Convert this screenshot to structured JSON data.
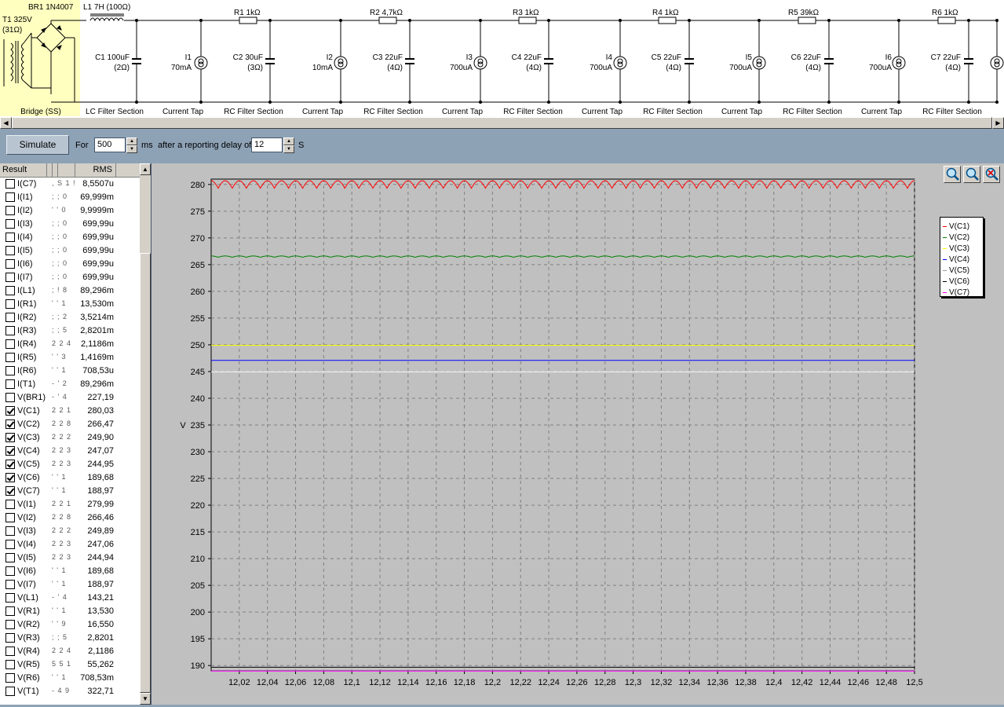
{
  "schematic": {
    "labels": {
      "br1": "BR1 1N4007",
      "t1": "T1 325V",
      "t1r": "(31Ω)",
      "l1": "L1 7H (100Ω)",
      "r1": "R1 1kΩ",
      "r2": "R2 4,7kΩ",
      "r3": "R3 1kΩ",
      "r4": "R4 1kΩ",
      "r5": "R5 39kΩ",
      "r6": "R6 1kΩ",
      "c1": "C1 100uF",
      "c1r": "(2Ω)",
      "c2": "C2 30uF",
      "c2r": "(3Ω)",
      "c3": "C3 22uF",
      "c3r": "(4Ω)",
      "c4": "C4 22uF",
      "c4r": "(4Ω)",
      "c5": "C5 22uF",
      "c5r": "(4Ω)",
      "c6": "C6 22uF",
      "c6r": "(4Ω)",
      "c7": "C7 22uF",
      "c7r": "(4Ω)",
      "i1": "I1",
      "i1v": "70mA",
      "i2": "I2",
      "i2v": "10mA",
      "i3": "I3",
      "i3v": "700uA",
      "i4": "I4",
      "i4v": "700uA",
      "i5": "I5",
      "i5v": "700uA",
      "i6": "I6",
      "i6v": "700uA"
    },
    "sections": {
      "bridge": "Bridge (SS)",
      "lc": "LC Filter Section",
      "ct1": "Current Tap",
      "rc1": "RC Filter Section",
      "ct2": "Current Tap",
      "rc2": "RC Filter Section",
      "ct3": "Current Tap",
      "rc3": "RC Filter Section",
      "ct4": "Current Tap",
      "rc4": "RC Filter Section",
      "ct5": "Current Tap",
      "rc5": "RC Filter Section",
      "ct6": "Current Tap",
      "rc6": "RC Filter Section"
    }
  },
  "toolbar": {
    "simulate": "Simulate",
    "for_label": "For",
    "duration": "500",
    "ms_label": "ms",
    "delay_label": "after a reporting delay of",
    "delay": "12",
    "s_label": "S"
  },
  "results": {
    "col_result": "Result",
    "col_rms": "RMS",
    "rows": [
      {
        "name": "I(C7)",
        "mid": ", S 1 !",
        "rms": "8,5507u",
        "checked": false
      },
      {
        "name": "I(I1)",
        "mid": "; ; 0",
        "rms": "69,999m",
        "checked": false
      },
      {
        "name": "I(I2)",
        "mid": "' ' 0",
        "rms": "9,9999m",
        "checked": false
      },
      {
        "name": "I(I3)",
        "mid": "; ; 0",
        "rms": "699,99u",
        "checked": false
      },
      {
        "name": "I(I4)",
        "mid": "; ; 0",
        "rms": "699,99u",
        "checked": false
      },
      {
        "name": "I(I5)",
        "mid": "; ; 0",
        "rms": "699,99u",
        "checked": false
      },
      {
        "name": "I(I6)",
        "mid": "; ; 0",
        "rms": "699,99u",
        "checked": false
      },
      {
        "name": "I(I7)",
        "mid": "; ; 0",
        "rms": "699,99u",
        "checked": false
      },
      {
        "name": "I(L1)",
        "mid": "; ! 8",
        "rms": "89,296m",
        "checked": false
      },
      {
        "name": "I(R1)",
        "mid": "' ' 1",
        "rms": "13,530m",
        "checked": false
      },
      {
        "name": "I(R2)",
        "mid": "; ; 2",
        "rms": "3,5214m",
        "checked": false
      },
      {
        "name": "I(R3)",
        "mid": "; ; 5",
        "rms": "2,8201m",
        "checked": false
      },
      {
        "name": "I(R4)",
        "mid": "2 2 4",
        "rms": "2,1186m",
        "checked": false
      },
      {
        "name": "I(R5)",
        "mid": "' ' 3",
        "rms": "1,4169m",
        "checked": false
      },
      {
        "name": "I(R6)",
        "mid": "' ' 1",
        "rms": "708,53u",
        "checked": false
      },
      {
        "name": "I(T1)",
        "mid": "- ' 2",
        "rms": "89,296m",
        "checked": false
      },
      {
        "name": "V(BR1)",
        "mid": "- ' 4",
        "rms": "227,19",
        "checked": false
      },
      {
        "name": "V(C1)",
        "mid": "2 2 1",
        "rms": "280,03",
        "checked": true
      },
      {
        "name": "V(C2)",
        "mid": "2 2 8",
        "rms": "266,47",
        "checked": true
      },
      {
        "name": "V(C3)",
        "mid": "2 2 2",
        "rms": "249,90",
        "checked": true
      },
      {
        "name": "V(C4)",
        "mid": "2 2 3",
        "rms": "247,07",
        "checked": true
      },
      {
        "name": "V(C5)",
        "mid": "2 2 3",
        "rms": "244,95",
        "checked": true
      },
      {
        "name": "V(C6)",
        "mid": "' ' 1",
        "rms": "189,68",
        "checked": true
      },
      {
        "name": "V(C7)",
        "mid": "' ' 1",
        "rms": "188,97",
        "checked": true
      },
      {
        "name": "V(I1)",
        "mid": "2 2 1",
        "rms": "279,99",
        "checked": false
      },
      {
        "name": "V(I2)",
        "mid": "2 2 8",
        "rms": "266,46",
        "checked": false
      },
      {
        "name": "V(I3)",
        "mid": "2 2 2",
        "rms": "249,89",
        "checked": false
      },
      {
        "name": "V(I4)",
        "mid": "2 2 3",
        "rms": "247,06",
        "checked": false
      },
      {
        "name": "V(I5)",
        "mid": "2 2 3",
        "rms": "244,94",
        "checked": false
      },
      {
        "name": "V(I6)",
        "mid": "' ' 1",
        "rms": "189,68",
        "checked": false
      },
      {
        "name": "V(I7)",
        "mid": "' ' 1",
        "rms": "188,97",
        "checked": false
      },
      {
        "name": "V(L1)",
        "mid": "- ' 4",
        "rms": "143,21",
        "checked": false
      },
      {
        "name": "V(R1)",
        "mid": "' ' 1",
        "rms": "13,530",
        "checked": false
      },
      {
        "name": "V(R2)",
        "mid": "' ' 9",
        "rms": "16,550",
        "checked": false
      },
      {
        "name": "V(R3)",
        "mid": "; ; 5",
        "rms": "2,8201",
        "checked": false
      },
      {
        "name": "V(R4)",
        "mid": "2 2 4",
        "rms": "2,1186",
        "checked": false
      },
      {
        "name": "V(R5)",
        "mid": "5 5 1",
        "rms": "55,262",
        "checked": false
      },
      {
        "name": "V(R6)",
        "mid": "' ' 1",
        "rms": "708,53m",
        "checked": false
      },
      {
        "name": "V(T1)",
        "mid": "- 4 9",
        "rms": "322,71",
        "checked": false
      }
    ]
  },
  "chart_data": {
    "type": "line",
    "ylabel": "V",
    "xlabel": "",
    "xlim": [
      12.0,
      12.5
    ],
    "ylim": [
      189,
      281
    ],
    "yticks": [
      190,
      195,
      200,
      205,
      210,
      215,
      220,
      225,
      230,
      235,
      240,
      245,
      250,
      255,
      260,
      265,
      270,
      275,
      280
    ],
    "ytick_labels": [
      "190",
      "195",
      "200",
      "205",
      "210",
      "215",
      "220",
      "225",
      "230",
      "235",
      "240",
      "245",
      "250",
      "255",
      "260",
      "265",
      "270",
      "275",
      "280"
    ],
    "xticks": [
      12.02,
      12.04,
      12.06,
      12.08,
      12.1,
      12.12,
      12.14,
      12.16,
      12.18,
      12.2,
      12.22,
      12.24,
      12.26,
      12.28,
      12.3,
      12.32,
      12.34,
      12.36,
      12.38,
      12.4,
      12.42,
      12.44,
      12.46,
      12.48,
      12.5
    ],
    "xtick_labels": [
      "12,02",
      "12,04",
      "12,06",
      "12,08",
      "12,1",
      "12,12",
      "12,14",
      "12,16",
      "12,18",
      "12,2",
      "12,22",
      "12,24",
      "12,26",
      "12,28",
      "12,3",
      "12,32",
      "12,34",
      "12,36",
      "12,38",
      "12,4",
      "12,42",
      "12,44",
      "12,46",
      "12,48",
      "12,5"
    ],
    "grid": true,
    "legend_position": "right",
    "series": [
      {
        "name": "V(C1)",
        "color": "#ff0000",
        "mean": 280.0,
        "ripple": 0.7,
        "freq_hz": 100
      },
      {
        "name": "V(C2)",
        "color": "#008000",
        "mean": 266.5,
        "ripple": 0.12,
        "freq_hz": 100
      },
      {
        "name": "V(C3)",
        "color": "#ffff00",
        "mean": 249.9,
        "ripple": 0,
        "freq_hz": 100
      },
      {
        "name": "V(C4)",
        "color": "#0000ff",
        "mean": 247.1,
        "ripple": 0,
        "freq_hz": 100
      },
      {
        "name": "V(C5)",
        "color": "#ffffff",
        "mean": 244.95,
        "ripple": 0,
        "freq_hz": 100
      },
      {
        "name": "V(C6)",
        "color": "#000000",
        "mean": 189.68,
        "ripple": 0,
        "freq_hz": 100
      },
      {
        "name": "V(C7)",
        "color": "#ff00ff",
        "mean": 188.97,
        "ripple": 0,
        "freq_hz": 100
      }
    ]
  }
}
